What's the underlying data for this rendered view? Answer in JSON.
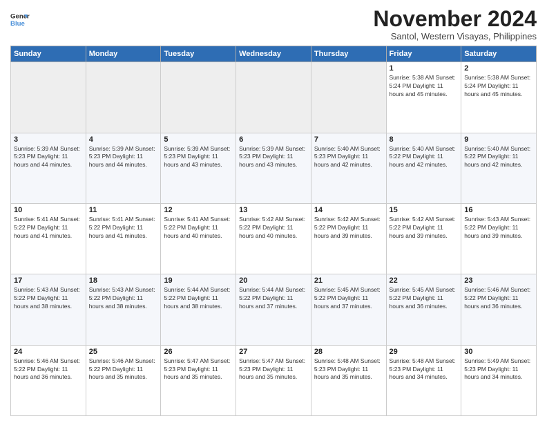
{
  "logo": {
    "line1": "General",
    "line2": "Blue"
  },
  "title": "November 2024",
  "location": "Santol, Western Visayas, Philippines",
  "days_of_week": [
    "Sunday",
    "Monday",
    "Tuesday",
    "Wednesday",
    "Thursday",
    "Friday",
    "Saturday"
  ],
  "weeks": [
    [
      {
        "day": "",
        "info": ""
      },
      {
        "day": "",
        "info": ""
      },
      {
        "day": "",
        "info": ""
      },
      {
        "day": "",
        "info": ""
      },
      {
        "day": "",
        "info": ""
      },
      {
        "day": "1",
        "info": "Sunrise: 5:38 AM\nSunset: 5:24 PM\nDaylight: 11 hours and 45 minutes."
      },
      {
        "day": "2",
        "info": "Sunrise: 5:38 AM\nSunset: 5:24 PM\nDaylight: 11 hours and 45 minutes."
      }
    ],
    [
      {
        "day": "3",
        "info": "Sunrise: 5:39 AM\nSunset: 5:23 PM\nDaylight: 11 hours and 44 minutes."
      },
      {
        "day": "4",
        "info": "Sunrise: 5:39 AM\nSunset: 5:23 PM\nDaylight: 11 hours and 44 minutes."
      },
      {
        "day": "5",
        "info": "Sunrise: 5:39 AM\nSunset: 5:23 PM\nDaylight: 11 hours and 43 minutes."
      },
      {
        "day": "6",
        "info": "Sunrise: 5:39 AM\nSunset: 5:23 PM\nDaylight: 11 hours and 43 minutes."
      },
      {
        "day": "7",
        "info": "Sunrise: 5:40 AM\nSunset: 5:23 PM\nDaylight: 11 hours and 42 minutes."
      },
      {
        "day": "8",
        "info": "Sunrise: 5:40 AM\nSunset: 5:22 PM\nDaylight: 11 hours and 42 minutes."
      },
      {
        "day": "9",
        "info": "Sunrise: 5:40 AM\nSunset: 5:22 PM\nDaylight: 11 hours and 42 minutes."
      }
    ],
    [
      {
        "day": "10",
        "info": "Sunrise: 5:41 AM\nSunset: 5:22 PM\nDaylight: 11 hours and 41 minutes."
      },
      {
        "day": "11",
        "info": "Sunrise: 5:41 AM\nSunset: 5:22 PM\nDaylight: 11 hours and 41 minutes."
      },
      {
        "day": "12",
        "info": "Sunrise: 5:41 AM\nSunset: 5:22 PM\nDaylight: 11 hours and 40 minutes."
      },
      {
        "day": "13",
        "info": "Sunrise: 5:42 AM\nSunset: 5:22 PM\nDaylight: 11 hours and 40 minutes."
      },
      {
        "day": "14",
        "info": "Sunrise: 5:42 AM\nSunset: 5:22 PM\nDaylight: 11 hours and 39 minutes."
      },
      {
        "day": "15",
        "info": "Sunrise: 5:42 AM\nSunset: 5:22 PM\nDaylight: 11 hours and 39 minutes."
      },
      {
        "day": "16",
        "info": "Sunrise: 5:43 AM\nSunset: 5:22 PM\nDaylight: 11 hours and 39 minutes."
      }
    ],
    [
      {
        "day": "17",
        "info": "Sunrise: 5:43 AM\nSunset: 5:22 PM\nDaylight: 11 hours and 38 minutes."
      },
      {
        "day": "18",
        "info": "Sunrise: 5:43 AM\nSunset: 5:22 PM\nDaylight: 11 hours and 38 minutes."
      },
      {
        "day": "19",
        "info": "Sunrise: 5:44 AM\nSunset: 5:22 PM\nDaylight: 11 hours and 38 minutes."
      },
      {
        "day": "20",
        "info": "Sunrise: 5:44 AM\nSunset: 5:22 PM\nDaylight: 11 hours and 37 minutes."
      },
      {
        "day": "21",
        "info": "Sunrise: 5:45 AM\nSunset: 5:22 PM\nDaylight: 11 hours and 37 minutes."
      },
      {
        "day": "22",
        "info": "Sunrise: 5:45 AM\nSunset: 5:22 PM\nDaylight: 11 hours and 36 minutes."
      },
      {
        "day": "23",
        "info": "Sunrise: 5:46 AM\nSunset: 5:22 PM\nDaylight: 11 hours and 36 minutes."
      }
    ],
    [
      {
        "day": "24",
        "info": "Sunrise: 5:46 AM\nSunset: 5:22 PM\nDaylight: 11 hours and 36 minutes."
      },
      {
        "day": "25",
        "info": "Sunrise: 5:46 AM\nSunset: 5:22 PM\nDaylight: 11 hours and 35 minutes."
      },
      {
        "day": "26",
        "info": "Sunrise: 5:47 AM\nSunset: 5:23 PM\nDaylight: 11 hours and 35 minutes."
      },
      {
        "day": "27",
        "info": "Sunrise: 5:47 AM\nSunset: 5:23 PM\nDaylight: 11 hours and 35 minutes."
      },
      {
        "day": "28",
        "info": "Sunrise: 5:48 AM\nSunset: 5:23 PM\nDaylight: 11 hours and 35 minutes."
      },
      {
        "day": "29",
        "info": "Sunrise: 5:48 AM\nSunset: 5:23 PM\nDaylight: 11 hours and 34 minutes."
      },
      {
        "day": "30",
        "info": "Sunrise: 5:49 AM\nSunset: 5:23 PM\nDaylight: 11 hours and 34 minutes."
      }
    ]
  ]
}
